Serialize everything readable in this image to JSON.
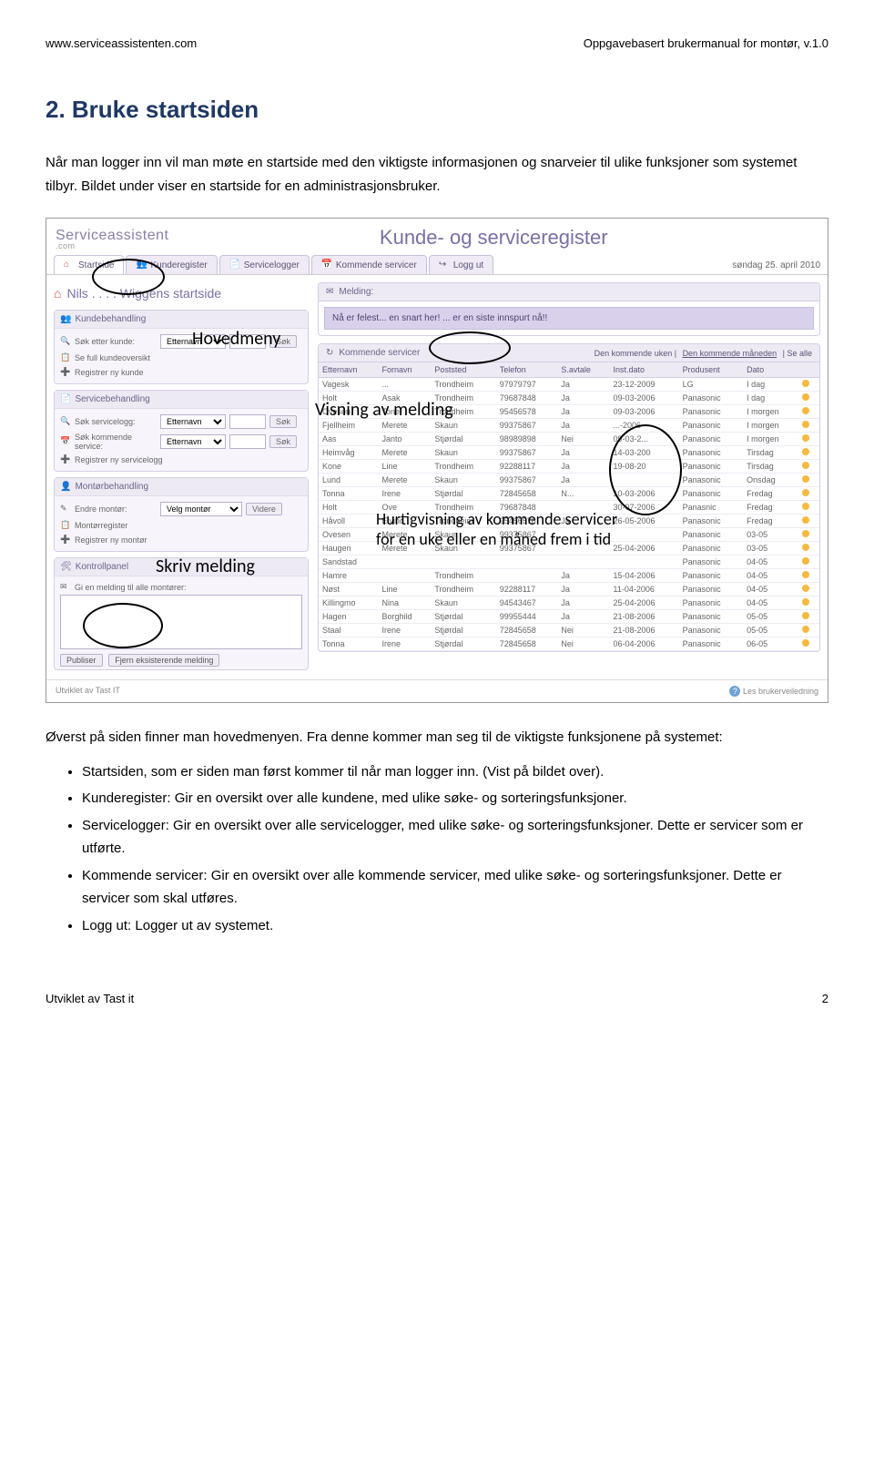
{
  "header": {
    "left": "www.serviceassistenten.com",
    "right": "Oppgavebasert brukermanual for montør, v.1.0"
  },
  "title": "2. Bruke startsiden",
  "intro1": "Når man logger inn vil man møte en startside med den viktigste informasjonen og snarveier til ulike funksjoner som systemet tilbyr. Bildet under viser en startside for en administrasjonsbruker.",
  "intro2": "Øverst på siden finner man hovedmenyen. Fra denne kommer man seg til de viktigste funksjonene på systemet:",
  "bullets": [
    "Startsiden, som er siden man først kommer til når man logger inn. (Vist på bildet over).",
    "Kunderegister: Gir en oversikt over alle kundene, med ulike søke- og sorteringsfunksjoner.",
    "Servicelogger: Gir en oversikt over alle servicelogger, med ulike søke- og sorteringsfunksjoner. Dette er servicer som er utførte.",
    "Kommende servicer: Gir en oversikt over alle kommende servicer, med ulike søke- og sorteringsfunksjoner. Dette er servicer som skal utføres.",
    "Logg ut: Logger ut av systemet."
  ],
  "footer": {
    "left": "Utviklet av Tast it",
    "right": "2"
  },
  "app": {
    "logo_main": "Serviceassistent",
    "logo_sub": ".com",
    "title": "Kunde- og serviceregister",
    "tabs": [
      "Startside",
      "Kunderegister",
      "Servicelogger",
      "Kommende servicer",
      "Logg ut"
    ],
    "date": "søndag 25. april 2010",
    "user_title": "Nils . . . . Wiggens startside",
    "kundebehandling": {
      "head": "Kundebehandling",
      "sok_lbl": "Søk etter kunde:",
      "sok_sel": "Etternavn",
      "btn": "Søk",
      "link1": "Se full kundeoversikt",
      "link2": "Registrer ny kunde"
    },
    "servicebehandling": {
      "head": "Servicebehandling",
      "sok1_lbl": "Søk servicelogg:",
      "sok2_lbl": "Søk kommende service:",
      "sel": "Etternavn",
      "btn": "Søk",
      "link": "Registrer ny servicelogg"
    },
    "montor": {
      "head": "Montørbehandling",
      "endre_lbl": "Endre montør:",
      "sel": "Velg montør",
      "btn": "Videre",
      "link1": "Montørregister",
      "link2": "Registrer ny montør"
    },
    "kontrollpanel": {
      "head": "Kontrollpanel",
      "msg_lbl": "Gi en melding til alle montører:",
      "btn1": "Publiser",
      "btn2": "Fjern eksisterende melding"
    },
    "melding": {
      "head": "Melding:",
      "text": "Nå er felest... en snart her! ... er en siste innspurt nå!!"
    },
    "kommende": {
      "head": "Kommende servicer",
      "filter_prefix": "Den kommende uken |",
      "filter_active": "Den kommende måneden",
      "filter_suffix": "| Se alle",
      "cols": [
        "Etternavn",
        "Fornavn",
        "Poststed",
        "Telefon",
        "S.avtale",
        "Inst.dato",
        "Produsent",
        "Dato"
      ],
      "rows": [
        [
          "Vagesk",
          "...",
          "Trondheim",
          "97979797",
          "Ja",
          "23-12-2009",
          "LG",
          "I dag"
        ],
        [
          "Holt",
          "Asak",
          "Trondheim",
          "79687848",
          "Ja",
          "09-03-2006",
          "Panasonic",
          "I dag"
        ],
        [
          "Ovesen",
          "Tone",
          "Trondheim",
          "95456578",
          "Ja",
          "09-03-2006",
          "Panasonic",
          "I morgen"
        ],
        [
          "Fjellheim",
          "Merete",
          "Skaun",
          "99375867",
          "Ja",
          "...-2006",
          "Panasonic",
          "I morgen"
        ],
        [
          "Aas",
          "Janto",
          "Stjørdal",
          "98989898",
          "Nei",
          "09-03-2...",
          "Panasonic",
          "I morgen"
        ],
        [
          "Heimvåg",
          "Merete",
          "Skaun",
          "99375867",
          "Ja",
          "14-03-200",
          "Panasonic",
          "Tirsdag"
        ],
        [
          "Kone",
          "Line",
          "Trondheim",
          "92288117",
          "Ja",
          "19-08-20",
          "Panasonic",
          "Tirsdag"
        ],
        [
          "Lund",
          "Merete",
          "Skaun",
          "99375867",
          "Ja",
          "",
          "Panasonic",
          "Onsdag"
        ],
        [
          "Tonna",
          "Irene",
          "Stjørdal",
          "72845658",
          "N...",
          "10-03-2006",
          "Panasonic",
          "Fredag"
        ],
        [
          "Holt",
          "Ove",
          "Trondheim",
          "79687848",
          "",
          "30-07-2006",
          "Panasnic",
          "Fredag"
        ],
        [
          "Håvoll",
          "Eivind",
          "Trondheim",
          "95456578",
          "Ja",
          "26-05-2006",
          "Panasonic",
          "Fredag"
        ],
        [
          "Ovesen",
          "Merete",
          "Skaun",
          "99375867",
          "",
          "",
          "Panasonic",
          "03-05"
        ],
        [
          "Haugen",
          "Merete",
          "Skaun",
          "99375867",
          "",
          "25-04-2006",
          "Panasonic",
          "03-05"
        ],
        [
          "Sandstad",
          "",
          "",
          "",
          "",
          "",
          "Panasonic",
          "04-05"
        ],
        [
          "Hamre",
          "",
          "Trondheim",
          "",
          "Ja",
          "15-04-2006",
          "Panasonic",
          "04-05"
        ],
        [
          "Nøst",
          "Line",
          "Trondheim",
          "92288117",
          "Ja",
          "11-04-2006",
          "Panasonic",
          "04-05"
        ],
        [
          "Killingmo",
          "Nina",
          "Skaun",
          "94543467",
          "Ja",
          "25-04-2006",
          "Panasonic",
          "04-05"
        ],
        [
          "Hagen",
          "Borghild",
          "Stjørdal",
          "99955444",
          "Ja",
          "21-08-2006",
          "Panasonic",
          "05-05"
        ],
        [
          "Staal",
          "Irene",
          "Stjørdal",
          "72845658",
          "Nei",
          "21-08-2006",
          "Panasonic",
          "05-05"
        ],
        [
          "Tonna",
          "Irene",
          "Stjørdal",
          "72845658",
          "Nei",
          "06-04-2006",
          "Panasonic",
          "06-05"
        ]
      ]
    },
    "footer_left": "Utviklet av Tast IT",
    "footer_right": "Les brukerveiledning"
  },
  "annotations": {
    "hovedmeny": "Hovedmeny",
    "visning": "Visning av melding",
    "skriv": "Skriv melding",
    "hurtig": "Hurtigvisning av kommende servicer for en uke eller en måned frem i tid"
  }
}
